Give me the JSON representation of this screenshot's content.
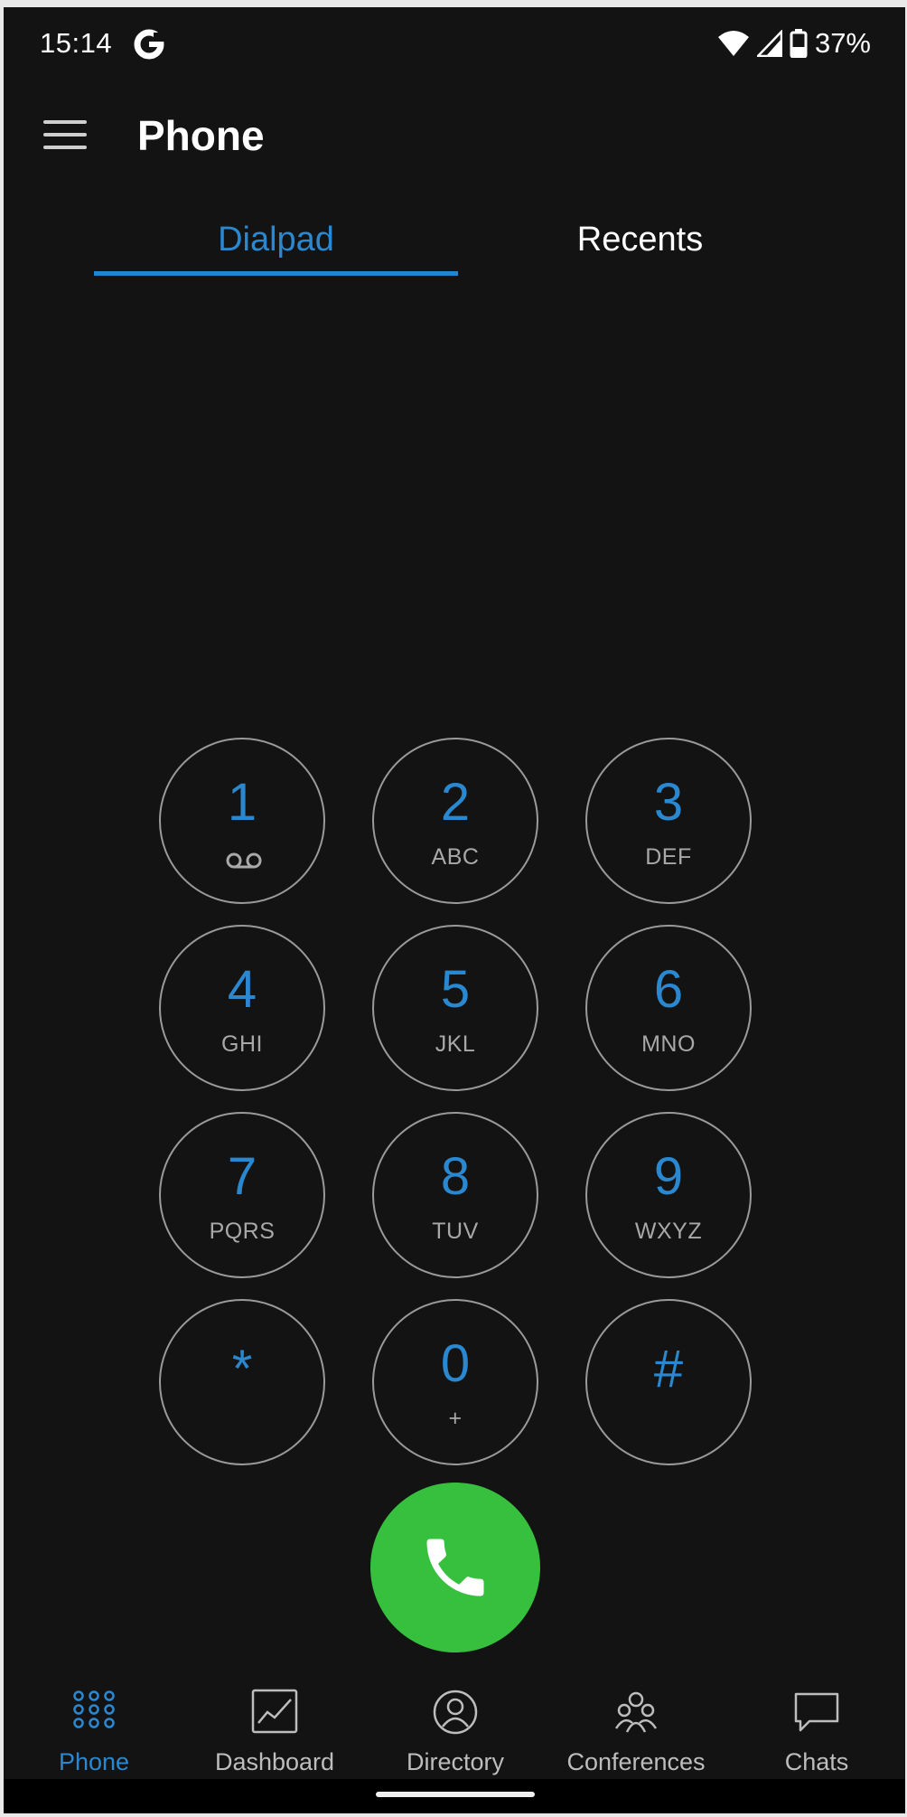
{
  "status_bar": {
    "time": "15:14",
    "battery_percent": "37%",
    "icons": [
      "google-icon",
      "wifi-icon",
      "cellular-signal-icon",
      "battery-icon"
    ]
  },
  "app_bar": {
    "title": "Phone",
    "menu_icon": "hamburger-menu-icon"
  },
  "tabs": [
    {
      "label": "Dialpad",
      "selected": true
    },
    {
      "label": "Recents",
      "selected": false
    }
  ],
  "keypad": {
    "keys": [
      {
        "digit": "1",
        "letters": "",
        "icon": "voicemail-icon"
      },
      {
        "digit": "2",
        "letters": "ABC"
      },
      {
        "digit": "3",
        "letters": "DEF"
      },
      {
        "digit": "4",
        "letters": "GHI"
      },
      {
        "digit": "5",
        "letters": "JKL"
      },
      {
        "digit": "6",
        "letters": "MNO"
      },
      {
        "digit": "7",
        "letters": "PQRS"
      },
      {
        "digit": "8",
        "letters": "TUV"
      },
      {
        "digit": "9",
        "letters": "WXYZ"
      },
      {
        "digit": "*",
        "letters": ""
      },
      {
        "digit": "0",
        "letters": "+"
      },
      {
        "digit": "#",
        "letters": ""
      }
    ]
  },
  "call_button": {
    "icon": "phone-handset-icon"
  },
  "bottom_nav": {
    "items": [
      {
        "label": "Phone",
        "icon": "dialpad-grid-icon",
        "active": true
      },
      {
        "label": "Dashboard",
        "icon": "chart-icon",
        "active": false
      },
      {
        "label": "Directory",
        "icon": "person-icon",
        "active": false
      },
      {
        "label": "Conferences",
        "icon": "group-icon",
        "active": false
      },
      {
        "label": "Chats",
        "icon": "chat-bubble-icon",
        "active": false
      }
    ]
  },
  "colors": {
    "background": "#131313",
    "accent": "#2a88d0",
    "call_green": "#37c03e",
    "key_border": "#9a9a9a"
  }
}
